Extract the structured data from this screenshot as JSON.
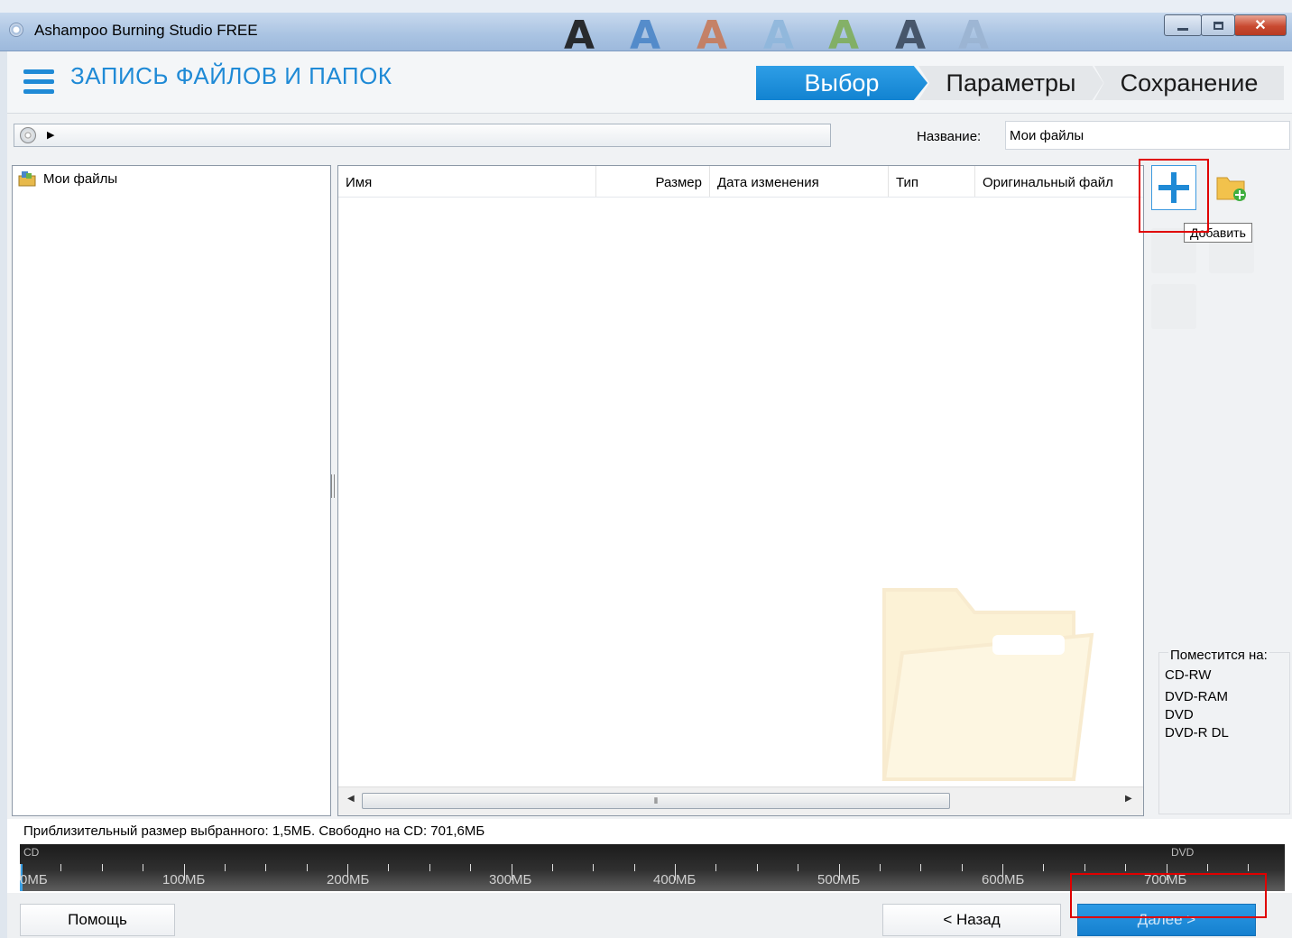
{
  "window": {
    "title": "Ashampoo Burning Studio FREE"
  },
  "header": {
    "title": "ЗАПИСЬ ФАЙЛОВ И ПАПОК",
    "steps": [
      {
        "label": "Выбор",
        "active": true
      },
      {
        "label": "Параметры",
        "active": false
      },
      {
        "label": "Сохранение",
        "active": false
      }
    ]
  },
  "pathbar": {
    "name_label": "Название:",
    "name_value": "Мои файлы"
  },
  "tree": {
    "root_label": "Мои файлы"
  },
  "filelist": {
    "columns": [
      "Имя",
      "Размер",
      "Дата изменения",
      "Тип",
      "Оригинальный файл"
    ],
    "rows": []
  },
  "toolbar": {
    "add_tooltip": "Добавить"
  },
  "fits": {
    "title": "Поместится на:",
    "items": [
      "CD-RW",
      "DVD-RAM",
      "DVD",
      "DVD-R DL"
    ]
  },
  "status": {
    "text": "Приблизительный размер выбранного: 1,5МБ. Свободно на CD: 701,6МБ"
  },
  "capacity_bar": {
    "left_label": "CD",
    "right_label": "DVD",
    "used_mb": 1.5,
    "scale_labels": [
      "0МБ",
      "100МБ",
      "200МБ",
      "300МБ",
      "400МБ",
      "500МБ",
      "600МБ",
      "700МБ"
    ]
  },
  "footer": {
    "help": "Помощь",
    "back": "< Назад",
    "next": "Далее >"
  },
  "colors": {
    "accent": "#1f8ad6",
    "highlight": "#e00000"
  },
  "icons": [
    "menu-icon",
    "cd-icon",
    "my-files-icon",
    "add-icon",
    "add-folder-icon",
    "folder-watermark-icon"
  ]
}
